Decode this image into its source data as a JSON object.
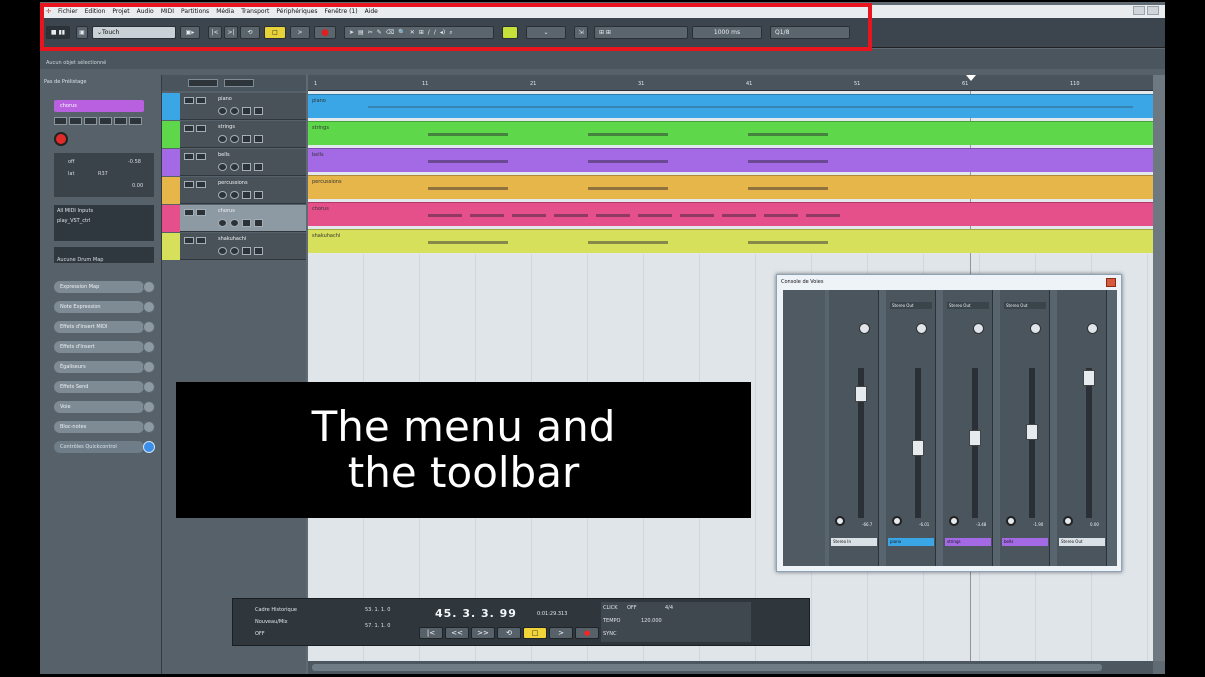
{
  "menu": [
    "Fichier",
    "Edition",
    "Projet",
    "Audio",
    "MIDI",
    "Partitions",
    "Média",
    "Transport",
    "Périphériques",
    "Fenêtre (1)",
    "Aide"
  ],
  "toolbar": {
    "automation_mode": "Touch",
    "grid_value": "1000 ms",
    "quantize": "1/8"
  },
  "status": "Aucun objet sélectionné",
  "inspector": {
    "header": "Pas de Prélistage",
    "track_name": "chorus",
    "values": {
      "off_label": "off",
      "off_value": "-0.58",
      "lat_label": "lat",
      "lat_value": "R37",
      "vol_label": "0.00"
    },
    "io_input": "All MIDI Inputs",
    "io_output": "play_VST_ctrl",
    "expression_map": "Aucune Drum Map",
    "sections": [
      "Expression Map",
      "Note Expression",
      "Effets d'Insert MIDI",
      "Effets d'Insert",
      "Égaliseurs",
      "Effets Send",
      "Voie",
      "Bloc-notes",
      "Contrôles Quickcontrol"
    ]
  },
  "tracks": [
    {
      "name": "piano",
      "color": "#3aa6e6"
    },
    {
      "name": "strings",
      "color": "#5ed84a"
    },
    {
      "name": "bells",
      "color": "#a46ae6"
    },
    {
      "name": "percussions",
      "color": "#e6b64a"
    },
    {
      "name": "chorus",
      "color": "#e6508a"
    },
    {
      "name": "shakuhachi",
      "color": "#d6e05a"
    }
  ],
  "ruler_ticks": [
    "1",
    "11",
    "21",
    "31",
    "41",
    "51",
    "61",
    "110"
  ],
  "transport": {
    "mode1": "Cadre Historique",
    "mode2": "Nouveau/Mix",
    "off": "OFF",
    "left_loc": "53. 1. 1. 0",
    "right_loc": "57. 1. 1. 0",
    "position": "45. 3. 3. 99",
    "timecode": "0:01:29.313",
    "sync": "OFF",
    "tempo": "120.000",
    "sig": "4/4",
    "click": "CLICK",
    "tempo_lbl": "TEMPO",
    "sync_lbl": "SYNC",
    "buttons": [
      "|<",
      "<<",
      ">>",
      "⟲",
      "□",
      ">",
      "●"
    ]
  },
  "mixer": {
    "title": "Console de Voies",
    "strips": [
      {
        "label": "Stereo In",
        "out": "",
        "vol": "-66.7"
      },
      {
        "label": "piano",
        "out": "Stereo Out",
        "vol": "-6.01",
        "color": "#3aa6e6"
      },
      {
        "label": "strings",
        "out": "Stereo Out",
        "vol": "-3.48",
        "color": "#a46ae6"
      },
      {
        "label": "bells",
        "out": "Stereo Out",
        "vol": "-1.90",
        "color": "#a46ae6"
      },
      {
        "label": "Stereo Out",
        "out": "",
        "vol": "0.00"
      }
    ]
  },
  "caption": {
    "line1": "The menu and",
    "line2": "the toolbar"
  }
}
